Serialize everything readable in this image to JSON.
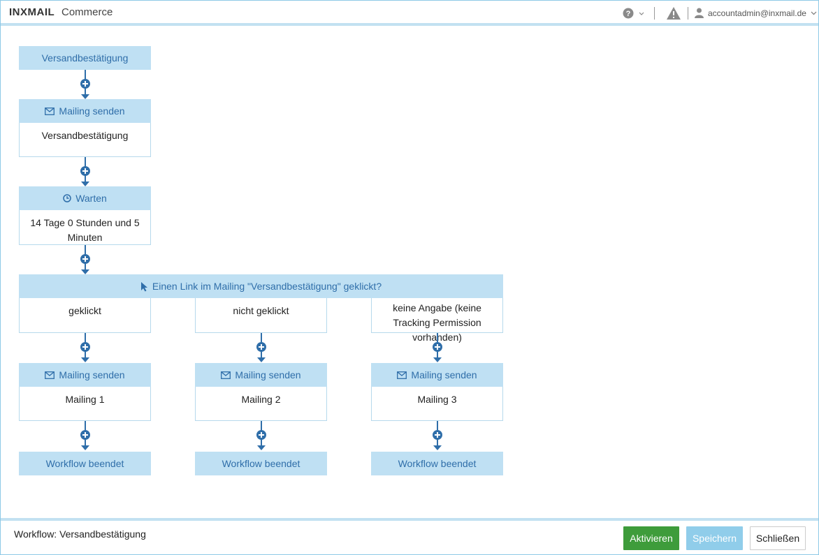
{
  "header": {
    "logo": "INXMAIL",
    "product": "Commerce",
    "help_icon": "question-circle-icon",
    "warning_icon": "warning-triangle-icon",
    "user": "accountadmin@inxmail.de"
  },
  "workflow": {
    "start": "Versandbestätigung",
    "step1": {
      "header": "Mailing senden",
      "body": "Versandbestätigung"
    },
    "step2": {
      "header": "Warten",
      "body": "14 Tage 0 Stunden und 5 Minuten"
    },
    "condition": {
      "header": "Einen Link im Mailing \"Versandbestätigung\" geklickt?",
      "branches": [
        "geklickt",
        "nicht geklickt",
        "keine Angabe (keine Tracking Permission vorhanden)"
      ]
    },
    "branch_steps": [
      {
        "header": "Mailing senden",
        "body": "Mailing 1",
        "end": "Workflow beendet"
      },
      {
        "header": "Mailing senden",
        "body": "Mailing 2",
        "end": "Workflow beendet"
      },
      {
        "header": "Mailing senden",
        "body": "Mailing 3",
        "end": "Workflow beendet"
      }
    ]
  },
  "footer": {
    "workflow_label": "Workflow: Versandbestätigung",
    "activate": "Aktivieren",
    "save": "Speichern",
    "close": "Schließen"
  },
  "colors": {
    "accent": "#2f6ea9",
    "node": "#bfe0f3",
    "activate": "#3e9c3b",
    "save": "#90cdea"
  }
}
